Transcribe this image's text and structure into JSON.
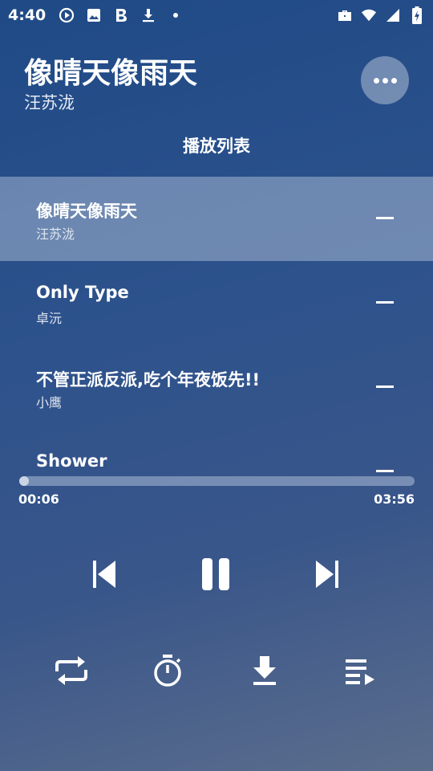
{
  "status_bar": {
    "time": "4:40",
    "left_icons": [
      "play-circle-icon",
      "image-icon",
      "bold-b-icon",
      "download-icon",
      "dot-icon"
    ],
    "right_icons": [
      "briefcase-icon",
      "wifi-icon",
      "signal-icon",
      "battery-charging-icon"
    ]
  },
  "now_playing": {
    "title": "像晴天像雨天",
    "artist": "汪苏泷"
  },
  "playlist": {
    "heading": "播放列表",
    "tracks": [
      {
        "title": "像晴天像雨天",
        "artist": "汪苏泷",
        "active": true
      },
      {
        "title": "Only Type",
        "artist": "卓沅",
        "active": false
      },
      {
        "title": "不管正派反派,吃个年夜饭先!!",
        "artist": "小鹰",
        "active": false
      },
      {
        "title": "Shower",
        "artist": "",
        "active": false
      }
    ]
  },
  "progress": {
    "current": "00:06",
    "total": "03:56",
    "fraction": 0.025
  },
  "controls": {
    "transport": [
      "previous-icon",
      "pause-icon",
      "next-icon"
    ],
    "bottom": [
      "repeat-icon",
      "timer-icon",
      "download-icon",
      "queue-icon"
    ]
  },
  "colors": {
    "background_top": "#1f4a86",
    "background_bottom": "#5b6d8c",
    "active_row": "#8fa0bd",
    "text": "#ffffff"
  }
}
